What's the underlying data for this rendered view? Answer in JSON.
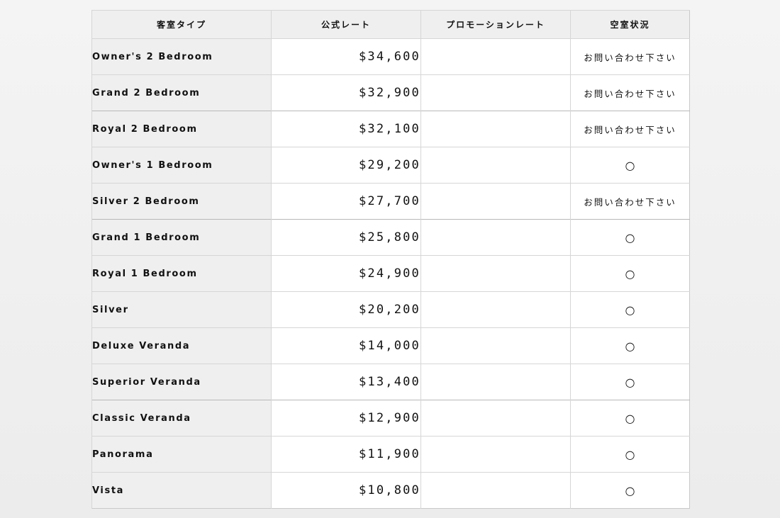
{
  "table": {
    "headers": {
      "room_type": "客室タイプ",
      "official_rate": "公式レート",
      "promo_rate": "プロモーションレート",
      "availability": "空室状況"
    },
    "rows": [
      {
        "room_type": "Owner's 2 Bedroom",
        "official_rate": "$34,600",
        "promo_rate": "",
        "availability": "お問い合わせ下さい"
      },
      {
        "room_type": "Grand 2 Bedroom",
        "official_rate": "$32,900",
        "promo_rate": "",
        "availability": "お問い合わせ下さい"
      },
      {
        "room_type": "Royal 2 Bedroom",
        "official_rate": "$32,100",
        "promo_rate": "",
        "availability": "お問い合わせ下さい"
      },
      {
        "room_type": "Owner's 1 Bedroom",
        "official_rate": "$29,200",
        "promo_rate": "",
        "availability": "○"
      },
      {
        "room_type": "Silver 2 Bedroom",
        "official_rate": "$27,700",
        "promo_rate": "",
        "availability": "お問い合わせ下さい"
      },
      {
        "room_type": "Grand 1 Bedroom",
        "official_rate": "$25,800",
        "promo_rate": "",
        "availability": "○"
      },
      {
        "room_type": "Royal 1 Bedroom",
        "official_rate": "$24,900",
        "promo_rate": "",
        "availability": "○"
      },
      {
        "room_type": "Silver",
        "official_rate": "$20,200",
        "promo_rate": "",
        "availability": "○"
      },
      {
        "room_type": "Deluxe Veranda",
        "official_rate": "$14,000",
        "promo_rate": "",
        "availability": "○"
      },
      {
        "room_type": "Superior Veranda",
        "official_rate": "$13,400",
        "promo_rate": "",
        "availability": "○"
      },
      {
        "room_type": "Classic Veranda",
        "official_rate": "$12,900",
        "promo_rate": "",
        "availability": "○"
      },
      {
        "room_type": "Panorama",
        "official_rate": "$11,900",
        "promo_rate": "",
        "availability": "○"
      },
      {
        "room_type": "Vista",
        "official_rate": "$10,800",
        "promo_rate": "",
        "availability": "○"
      }
    ]
  }
}
